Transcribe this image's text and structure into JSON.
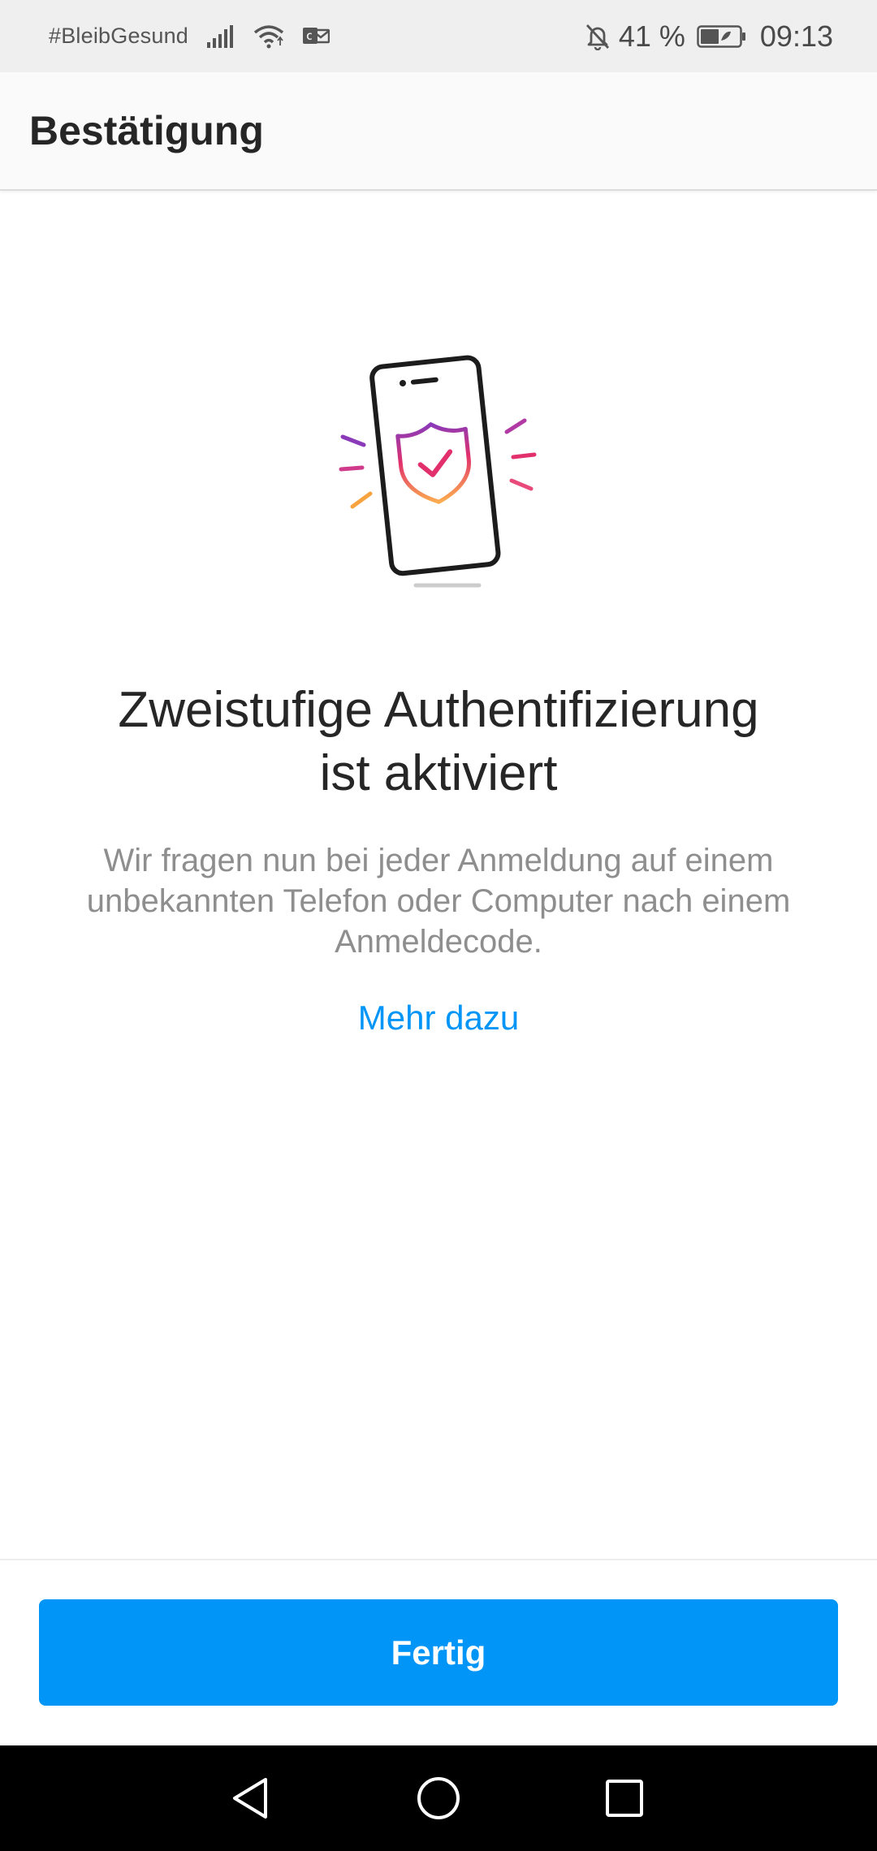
{
  "status_bar": {
    "carrier_text": "#BleibGesund",
    "battery_percent": "41 %",
    "time": "09:13",
    "icons": [
      "signal-icon",
      "wifi-icon",
      "notification-icon",
      "mute-icon",
      "battery-icon"
    ]
  },
  "app_bar": {
    "title": "Bestätigung"
  },
  "content": {
    "illustration": "phone-shield-check-icon",
    "headline_line1": "Zweistufige Authentifizierung",
    "headline_line2": "ist aktiviert",
    "description_line1": "Wir fragen nun bei jeder Anmeldung auf einem",
    "description_line2": "unbekannten Telefon oder Computer nach einem",
    "description_line3": "Anmeldecode.",
    "learn_more": "Mehr dazu"
  },
  "footer": {
    "done_label": "Fertig"
  },
  "nav_bar": {
    "icons": [
      "back-icon",
      "home-icon",
      "recents-icon"
    ]
  },
  "colors": {
    "accent": "#0095f6",
    "title_text": "#262626",
    "secondary_text": "#8e8e8e",
    "status_bar_bg": "#efefef",
    "nav_bar_bg": "#000000"
  }
}
